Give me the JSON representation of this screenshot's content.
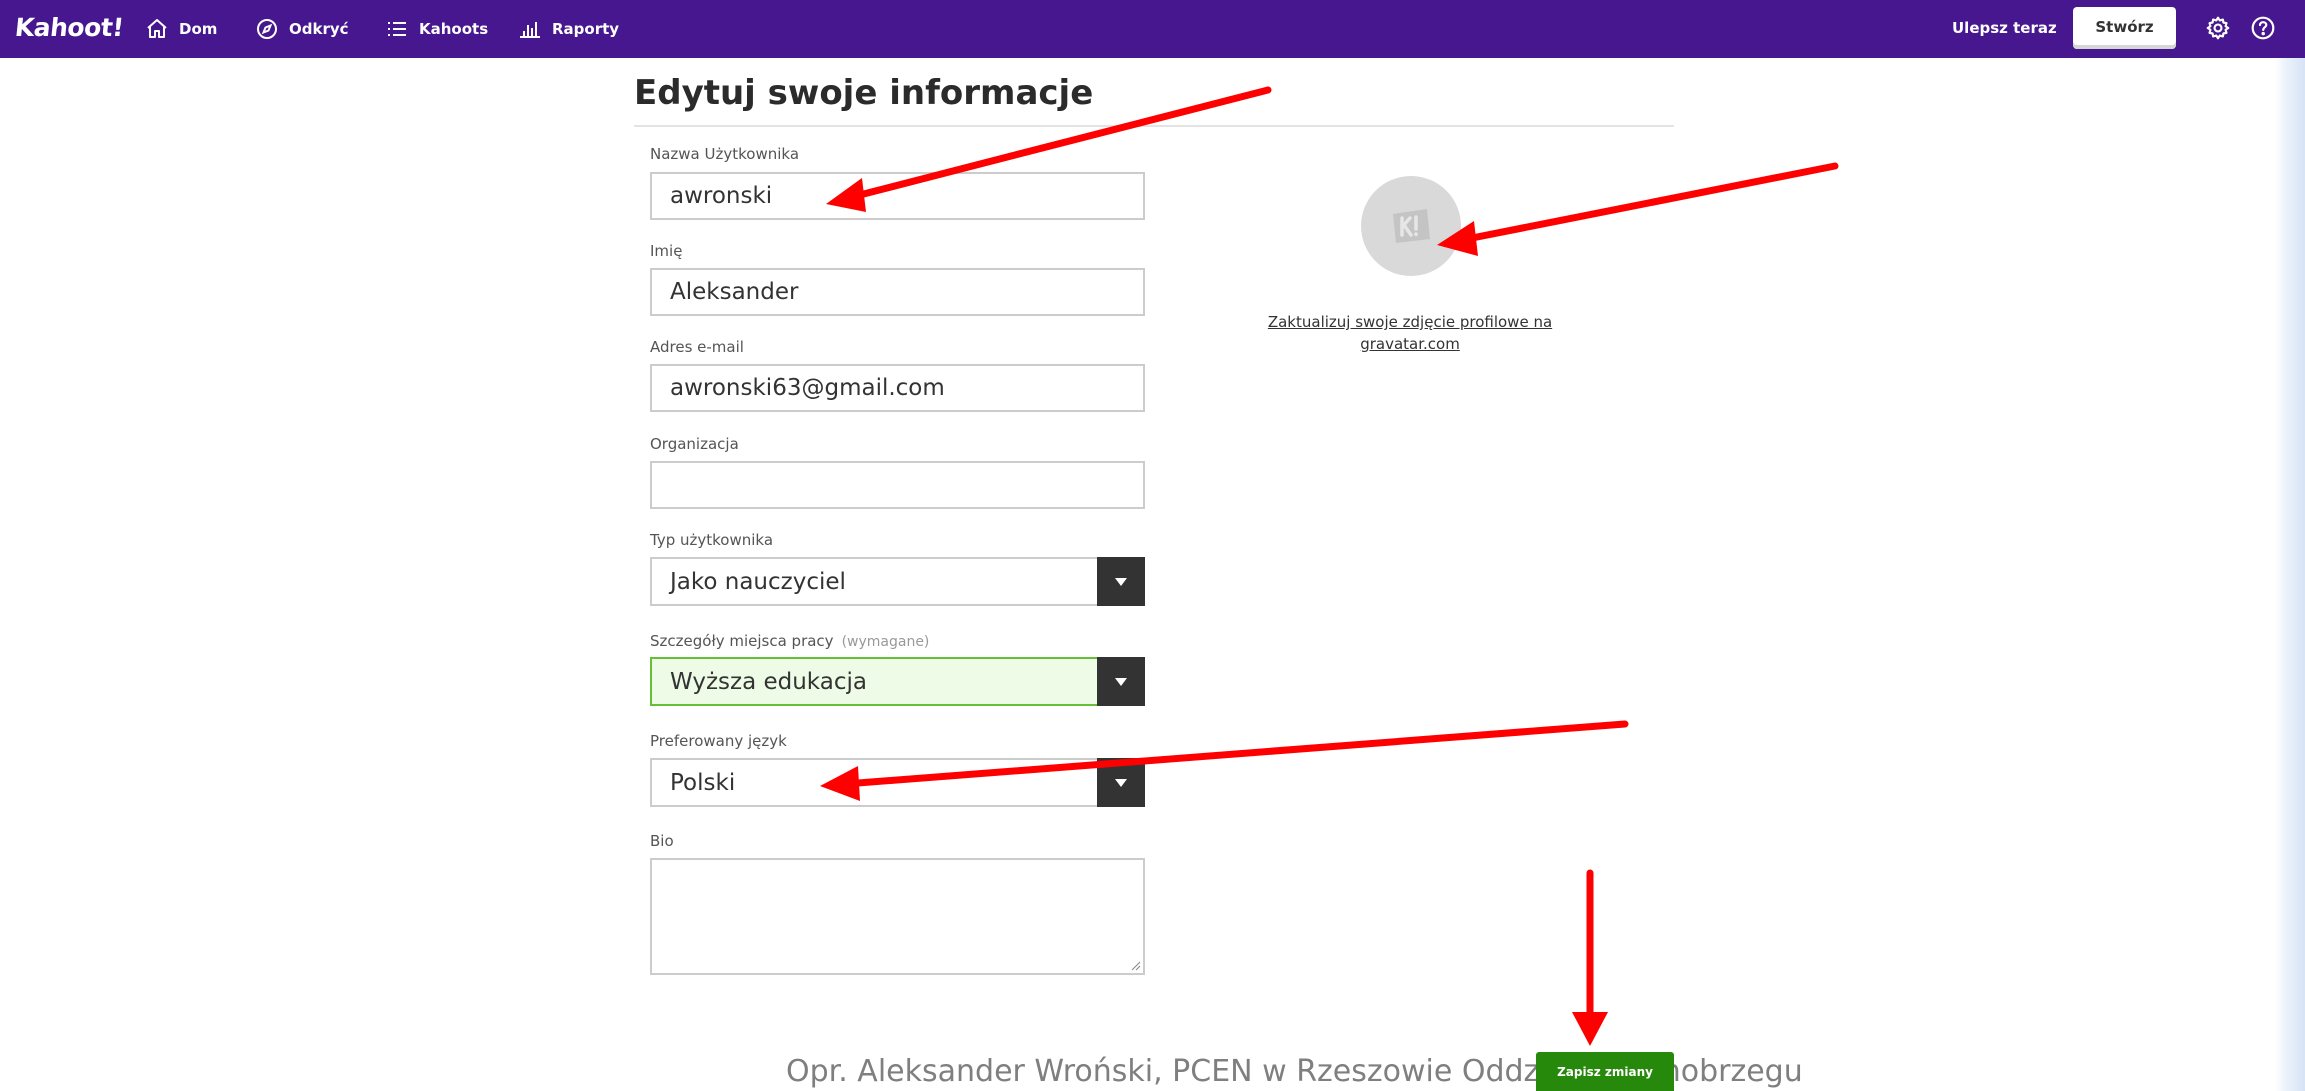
{
  "topbar": {
    "logo": "Kahoot!",
    "nav": [
      {
        "label": "Dom",
        "icon": "home-icon"
      },
      {
        "label": "Odkryć",
        "icon": "compass-icon"
      },
      {
        "label": "Kahoots",
        "icon": "list-icon"
      },
      {
        "label": "Raporty",
        "icon": "bar-chart-icon"
      }
    ],
    "upgrade_label": "Ulepsz teraz",
    "create_label": "Stwórz",
    "icons": [
      "gear-icon",
      "help-icon"
    ],
    "background_color": "#46178f"
  },
  "page": {
    "title": "Edytuj swoje informacje"
  },
  "form": {
    "username": {
      "label": "Nazwa Użytkownika",
      "value": "awronski"
    },
    "first_name": {
      "label": "Imię",
      "value": "Aleksander"
    },
    "email": {
      "label": "Adres e-mail",
      "value": "awronski63@gmail.com"
    },
    "organization": {
      "label": "Organizacja",
      "value": ""
    },
    "user_type": {
      "label": "Typ użytkownika",
      "value": "Jako nauczyciel"
    },
    "workplace": {
      "label": "Szczegóły miejsca pracy",
      "hint": "(wymagane)",
      "value": "Wyższa edukacja"
    },
    "language": {
      "label": "Preferowany język",
      "value": "Polski"
    },
    "bio": {
      "label": "Bio",
      "value": ""
    }
  },
  "profile": {
    "gravatar_link_line1": "Zaktualizuj swoje zdjęcie profilowe na",
    "gravatar_link_line2": "gravatar.com",
    "avatar_icon": "kahoot-placeholder-avatar-icon"
  },
  "actions": {
    "save_label": "Zapisz zmiany",
    "save_color": "#26890c"
  },
  "footer": {
    "caption": "Opr. Aleksander Wroński, PCEN w Rzeszowie Oddział w Tarnobrzegu"
  },
  "annotations": {
    "arrow_color": "#ff0000",
    "arrow_count": 5
  }
}
